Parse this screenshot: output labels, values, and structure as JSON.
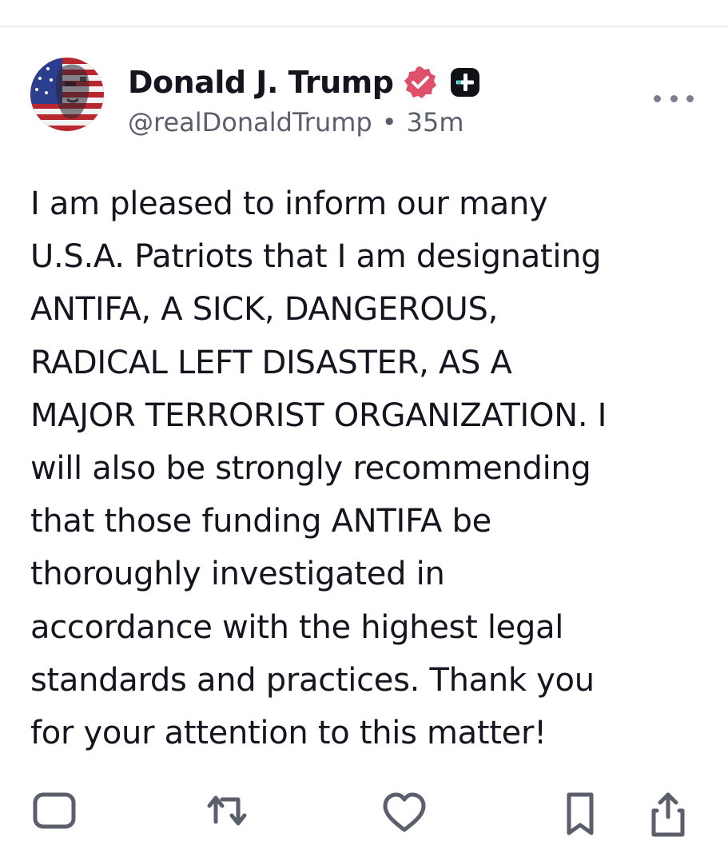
{
  "post": {
    "author": {
      "display_name": "Donald J. Trump",
      "handle": "@realDonaldTrump",
      "avatar_icon": "avatar-flag-portrait",
      "verified_icon": "verified-badge-icon",
      "plus_icon": "plus-badge-icon"
    },
    "separator": "•",
    "time_ago": "35m",
    "more_icon": "more-options-icon",
    "body_lines": [
      "I am pleased to inform our many",
      "U.S.A. Patriots that I am designating",
      "ANTIFA, A SICK, DANGEROUS,",
      "RADICAL LEFT DISASTER, AS A",
      "MAJOR TERRORIST ORGANIZATION. I",
      "will also be strongly recommending",
      "that those funding ANTIFA be",
      "thoroughly investigated in",
      "accordance with the highest legal",
      "standards and practices. Thank you",
      "for your attention to this matter!"
    ],
    "actions": [
      {
        "name": "reply",
        "icon": "comment-icon"
      },
      {
        "name": "retruth",
        "icon": "repost-icon"
      },
      {
        "name": "like",
        "icon": "heart-icon"
      },
      {
        "name": "bookmark",
        "icon": "bookmark-icon"
      },
      {
        "name": "share",
        "icon": "share-icon"
      }
    ]
  },
  "colors": {
    "text": "#15151f",
    "secondary_text": "#5b5e6b",
    "verified_badge": "#e0506b",
    "divider": "#ececef"
  }
}
